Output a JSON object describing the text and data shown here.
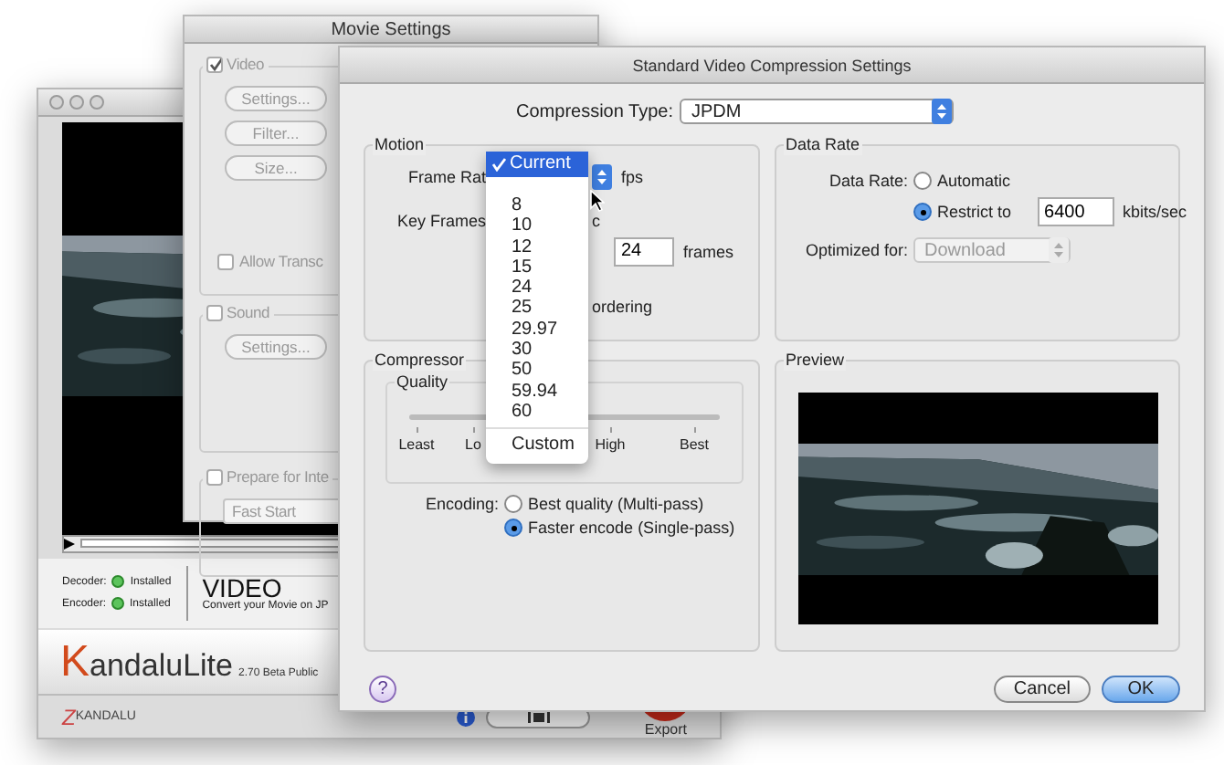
{
  "player_window": {
    "decoder": {
      "label": "Decoder:",
      "status": "Installed"
    },
    "encoder": {
      "label": "Encoder:",
      "status": "Installed"
    },
    "product": "VIDEO",
    "product_desc": "Convert your Movie on JP",
    "logo_initial": "K",
    "logo_rest": "andaluLite",
    "version": "2.70 Beta Public",
    "brand_mark": "Z",
    "brand": "KANDALU",
    "export": "Export"
  },
  "movie_settings": {
    "title": "Movie Settings",
    "video": {
      "label": "Video",
      "checked": true,
      "disabled": true
    },
    "video_buttons": [
      {
        "label": "Settings...",
        "disabled": true
      },
      {
        "label": "Filter...",
        "disabled": true
      },
      {
        "label": "Size...",
        "disabled": true
      }
    ],
    "allow": {
      "label": "Allow Transc",
      "checked": false,
      "disabled": true
    },
    "sound": {
      "label": "Sound",
      "checked": false,
      "disabled": true
    },
    "sound_buttons": [
      {
        "label": "Settings...",
        "disabled": true
      }
    ],
    "prepare": {
      "label": "Prepare for Inte",
      "checked": false,
      "disabled": true
    },
    "prepare_popup": {
      "value": "Fast Start",
      "disabled": true
    }
  },
  "compression_dialog": {
    "title": "Standard Video Compression Settings",
    "compression_type": {
      "label": "Compression Type:",
      "value": "JPDM"
    },
    "motion": {
      "legend": "Motion",
      "frame_rate_label": "Frame Rat",
      "fps": "fps",
      "key_frames_label": "Key Frames",
      "key_frames_fragment": "c",
      "key_frames_value": "24",
      "frames": "frames",
      "reordering_fragment": "ordering"
    },
    "frame_rate_menu": [
      {
        "label": "Current",
        "selected": true,
        "kind": "rate"
      },
      {
        "label": "8",
        "selected": false,
        "kind": "rate"
      },
      {
        "label": "10",
        "selected": false,
        "kind": "rate"
      },
      {
        "label": "12",
        "selected": false,
        "kind": "rate"
      },
      {
        "label": "15",
        "selected": false,
        "kind": "rate"
      },
      {
        "label": "24",
        "selected": false,
        "kind": "rate"
      },
      {
        "label": "25",
        "selected": false,
        "kind": "rate"
      },
      {
        "label": "29.97",
        "selected": false,
        "kind": "rate"
      },
      {
        "label": "30",
        "selected": false,
        "kind": "rate"
      },
      {
        "label": "50",
        "selected": false,
        "kind": "rate"
      },
      {
        "label": "59.94",
        "selected": false,
        "kind": "rate"
      },
      {
        "label": "60",
        "selected": false,
        "kind": "rate"
      },
      {
        "label": "Custom",
        "selected": false,
        "kind": "custom"
      }
    ],
    "data_rate": {
      "legend": "Data Rate",
      "label": "Data Rate:",
      "options": [
        {
          "label": "Automatic",
          "selected": false
        },
        {
          "label": "Restrict to",
          "selected": true
        }
      ],
      "value": "6400",
      "unit": "kbits/sec",
      "optimized_label": "Optimized for:",
      "optimized_value": "Download",
      "optimized_disabled": true
    },
    "compressor": {
      "legend": "Compressor",
      "quality_legend": "Quality",
      "ticks": [
        {
          "label": "Least"
        },
        {
          "label": "Lo"
        },
        {
          "label": "High"
        },
        {
          "label": "Best"
        }
      ],
      "encoding_label": "Encoding:",
      "encoding_options": [
        {
          "label": "Best quality (Multi-pass)",
          "selected": false
        },
        {
          "label": "Faster encode (Single-pass)",
          "selected": true
        }
      ]
    },
    "preview": {
      "legend": "Preview"
    },
    "help": "?",
    "buttons": [
      {
        "label": "Cancel",
        "default": false
      },
      {
        "label": "OK",
        "default": true
      }
    ]
  }
}
